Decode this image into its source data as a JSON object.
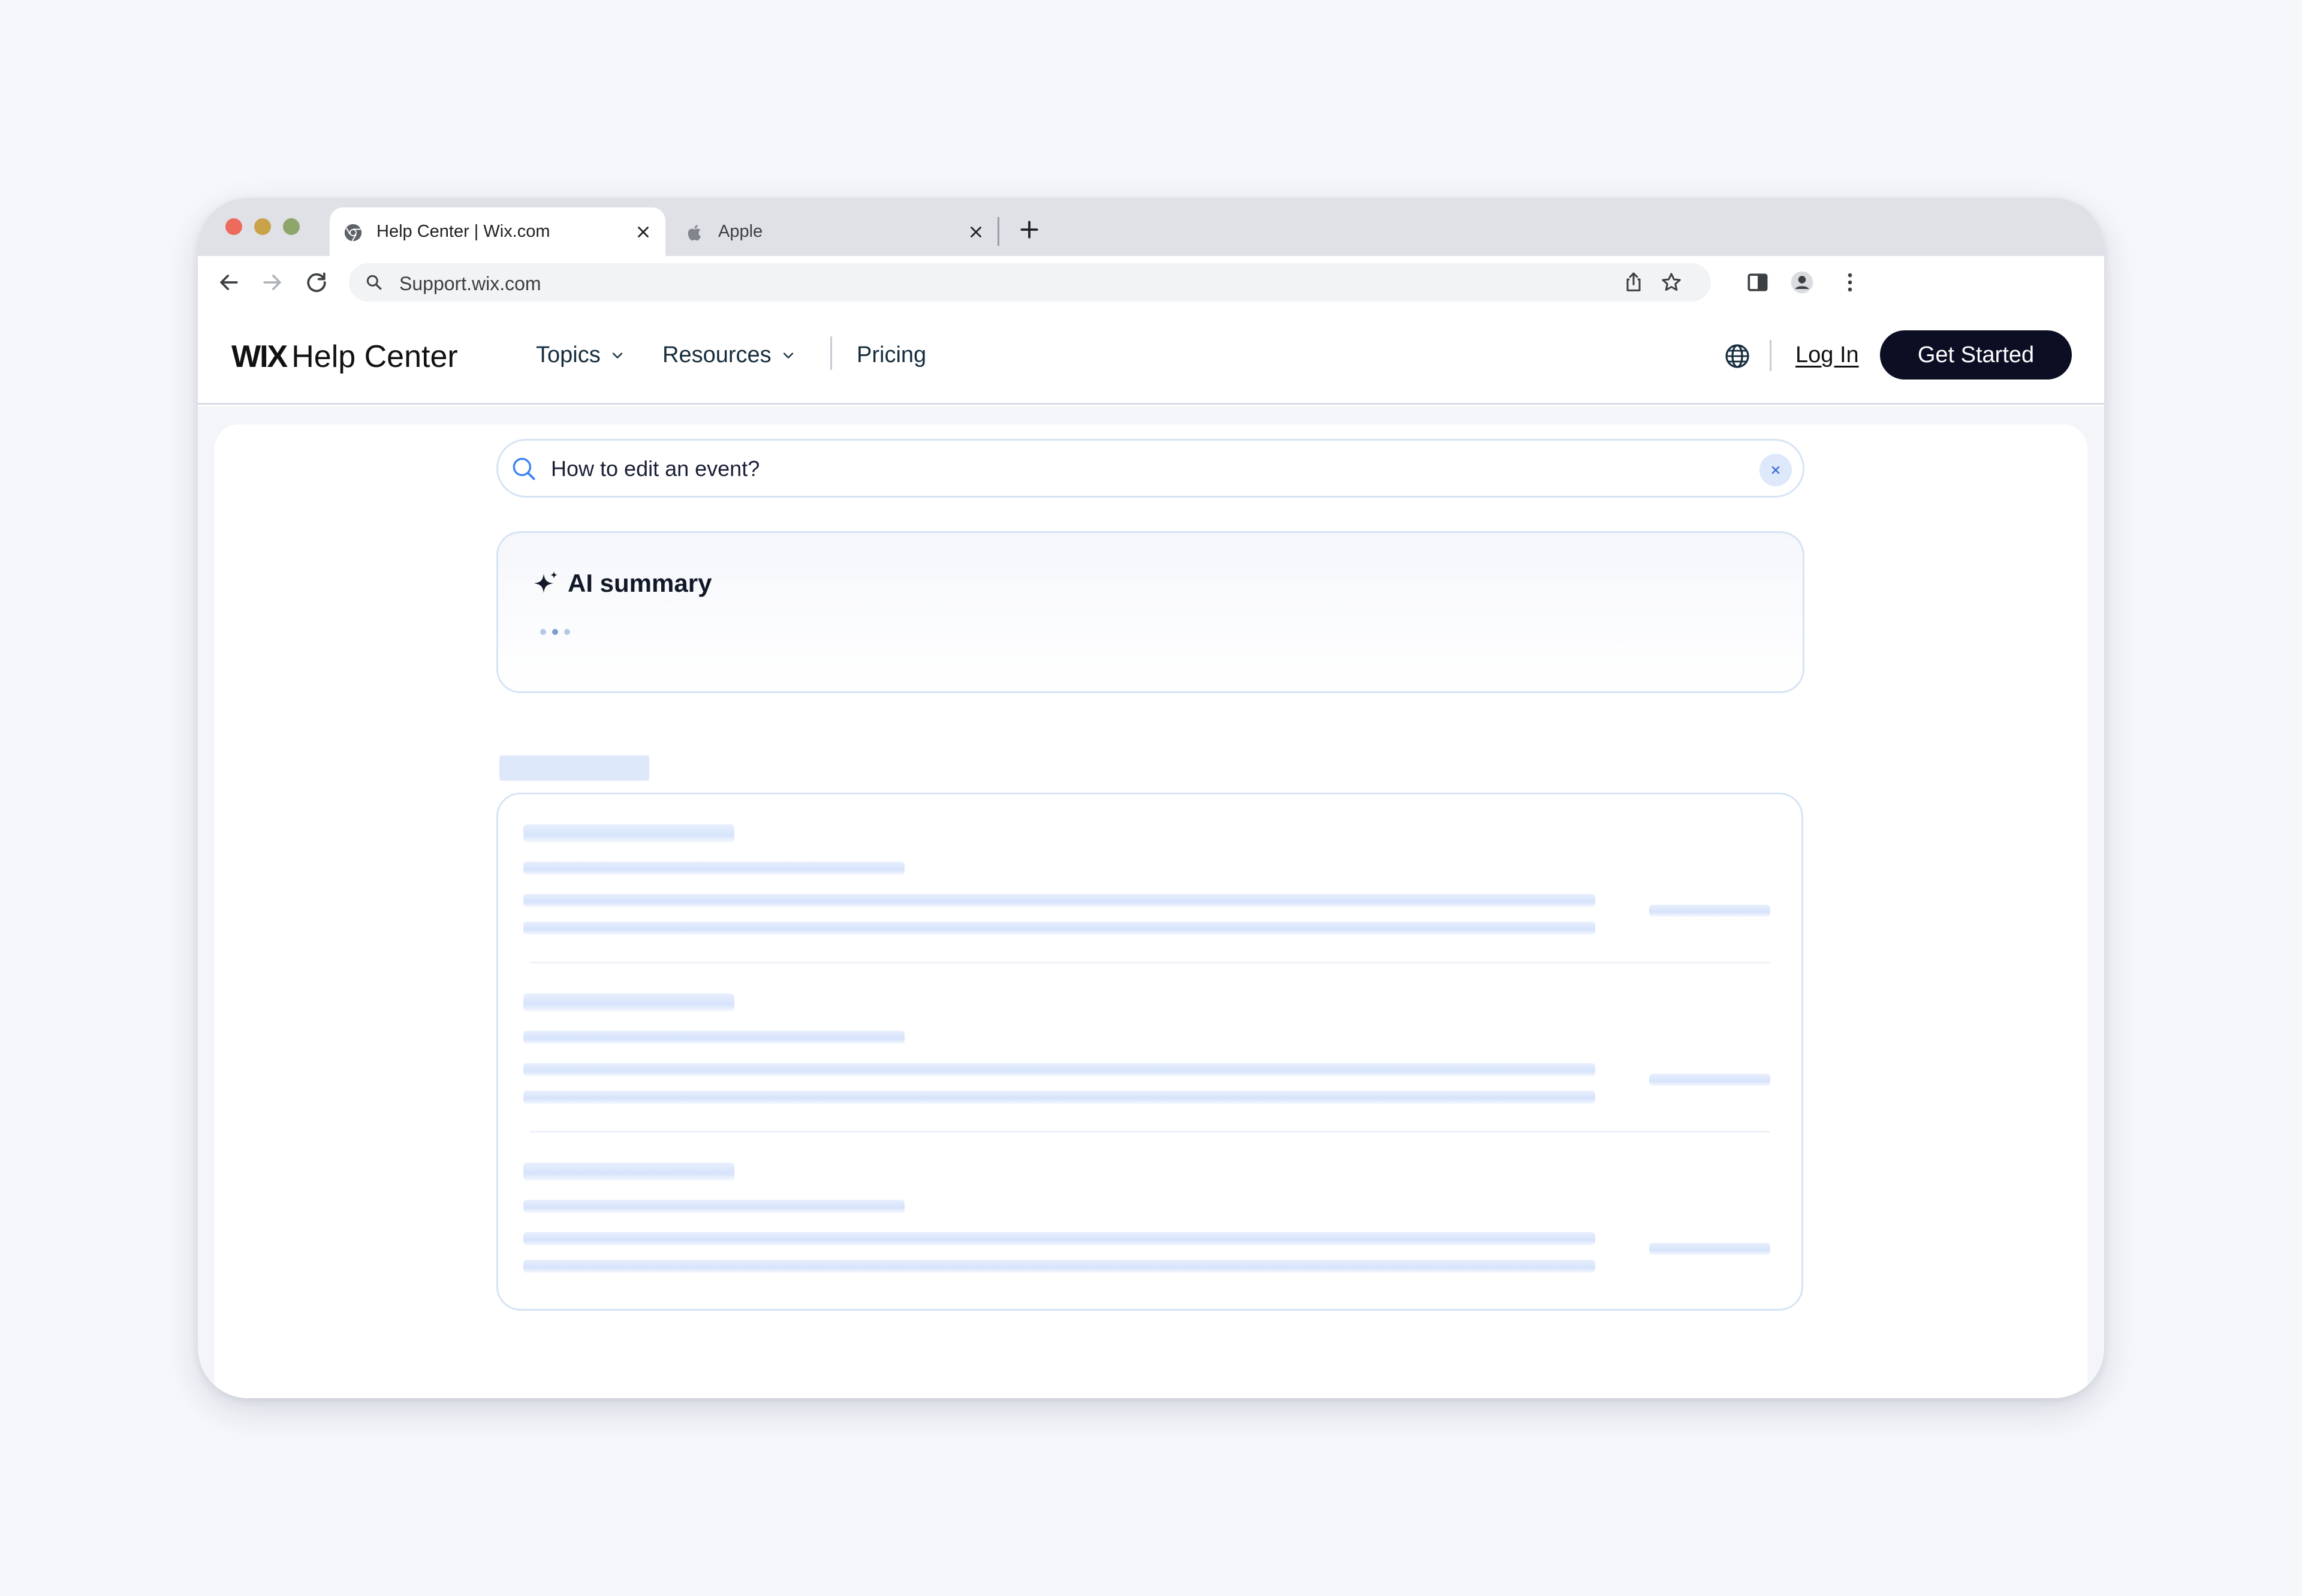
{
  "browser": {
    "tabs": [
      {
        "label": "Help Center | Wix.com",
        "icon": "chrome-icon",
        "active": true
      },
      {
        "label": "Apple",
        "icon": "apple-icon",
        "active": false
      }
    ],
    "url": "Support.wix.com"
  },
  "site": {
    "logo": {
      "brand": "WIX",
      "product": "Help Center"
    },
    "nav": {
      "topics": "Topics",
      "resources": "Resources",
      "pricing": "Pricing"
    },
    "login_label": "Log In",
    "cta_label": "Get Started"
  },
  "search": {
    "value": "How to edit an event?"
  },
  "ai_summary": {
    "title": "AI summary",
    "state": "loading"
  },
  "results": {
    "state": "loading",
    "placeholder_rows": 3
  },
  "colors": {
    "cta_background": "#0c0f24",
    "accent_blue": "#3b82f6",
    "skeleton": "#dde8fb"
  }
}
